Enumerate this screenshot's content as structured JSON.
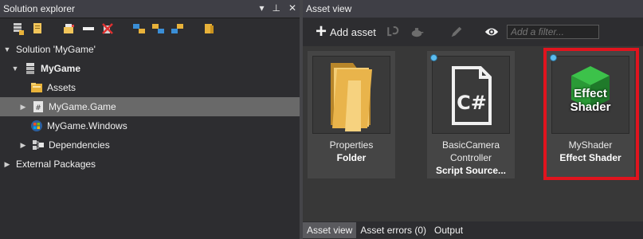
{
  "solution_explorer": {
    "title": "Solution explorer",
    "title_controls": [
      "▾",
      "⊥",
      "✕"
    ],
    "toolbar_icons": [
      "new-project-icon",
      "add-file-icon",
      "build-icon",
      "dock-icon",
      "delete-icon",
      "collapse-icon",
      "expand-icon",
      "sync-icon",
      "folder-icon"
    ],
    "tree": [
      {
        "label": "Solution 'MyGame'",
        "bold": false,
        "level": 0,
        "expanded": true
      },
      {
        "label": "MyGame",
        "bold": true,
        "level": 1,
        "expanded": true
      },
      {
        "label": "Assets",
        "bold": false,
        "level": 2
      },
      {
        "label": "MyGame.Game",
        "bold": false,
        "level": 2,
        "selected": true
      },
      {
        "label": "MyGame.Windows",
        "bold": false,
        "level": 2
      },
      {
        "label": "Dependencies",
        "bold": false,
        "level": 2
      },
      {
        "label": "External Packages",
        "bold": false,
        "level": 0
      }
    ]
  },
  "asset_view": {
    "title": "Asset view",
    "add_asset_label": "Add asset",
    "filter_placeholder": "Add a filter...",
    "assets": [
      {
        "name": "Properties",
        "type": "Folder",
        "icon": "folder-icon"
      },
      {
        "name": "BasicCamera\nController",
        "type": "Script Source...",
        "icon": "csharp-file-icon"
      },
      {
        "name": "MyShader",
        "type": "Effect Shader",
        "icon": "effect-shader-icon",
        "thumb_text": "Effect Shader",
        "highlighted": true
      }
    ]
  },
  "bottom_tabs": [
    {
      "label": "Asset view",
      "active": true
    },
    {
      "label": "Asset errors (0)",
      "active": false
    },
    {
      "label": "Output",
      "active": false
    }
  ],
  "colors": {
    "highlight": "#e0141e",
    "selection": "#696969",
    "status_dot": "#5bbcf0"
  }
}
